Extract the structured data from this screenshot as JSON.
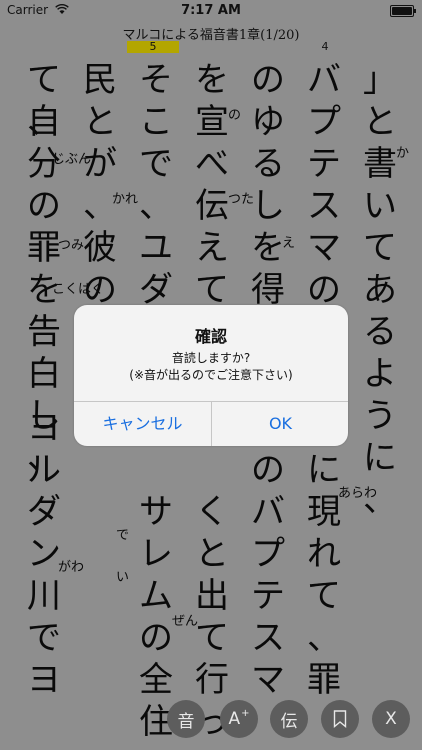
{
  "status": {
    "carrier": "Carrier",
    "time": "7:17 AM"
  },
  "header": {
    "title": "マルコによる福音書1章(1/20)",
    "page_current": "5",
    "page_next": "4"
  },
  "columns": [
    "」と書いてあるように、",
    "バプテスマのヨハ",
    "のゆるしを得させ",
    "を宣べ伝えていた",
    "そこで、ユダヤ全",
    "民とが、彼のもと",
    "自分の罪を告白し、",
    "て、",
    "ヨルダン川でヨ",
    "めのバプテスマ",
    "に現れて、罪",
    "くと出て行っ",
    "サレムの全住"
  ],
  "ruby": {
    "ka": "か",
    "arawa": "あらわ",
    "e": "え",
    "no": "の",
    "tsuta": "つた",
    "kare": "かれ",
    "zen": "ぜん",
    "de": "で",
    "i": "い",
    "jibun": "じぶん",
    "tsumi": "つみ",
    "kokuhaku": "こくはく",
    "gawa": "がわ"
  },
  "toolbar": {
    "sound": "音",
    "font": "A",
    "font_sup": "+",
    "tradition": "伝",
    "close": "X"
  },
  "dialog": {
    "title": "確認",
    "message_line1": "音読しますか?",
    "message_line2": "(※音が出るのでご注意下さい)",
    "cancel": "キャンセル",
    "ok": "OK"
  }
}
